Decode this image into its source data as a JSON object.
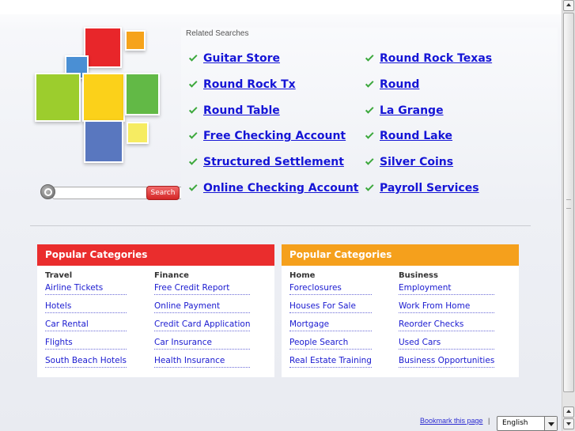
{
  "colors": {
    "red_header": "#ea2d2d",
    "orange_header": "#f5a01c",
    "link": "#1515d6",
    "check": "#3ca83c"
  },
  "search": {
    "placeholder": "",
    "button_label": "Search"
  },
  "related": {
    "title": "Related Searches",
    "left": [
      "Guitar Store",
      "Round Rock Tx",
      "Round Table",
      "Free Checking Account",
      "Structured Settlement",
      "Online Checking Account"
    ],
    "right": [
      "Round Rock Texas",
      "Round",
      "La Grange",
      "Round Lake",
      "Silver Coins",
      "Payroll Services"
    ]
  },
  "categories": [
    {
      "header": "Popular Categories",
      "columns": [
        {
          "title": "Travel",
          "links": [
            "Airline Tickets",
            "Hotels",
            "Car Rental",
            "Flights",
            "South Beach Hotels"
          ]
        },
        {
          "title": "Finance",
          "links": [
            "Free Credit Report",
            "Online Payment",
            "Credit Card Application",
            "Car Insurance",
            "Health Insurance"
          ]
        }
      ]
    },
    {
      "header": "Popular Categories",
      "columns": [
        {
          "title": "Home",
          "links": [
            "Foreclosures",
            "Houses For Sale",
            "Mortgage",
            "People Search",
            "Real Estate Training"
          ]
        },
        {
          "title": "Business",
          "links": [
            "Employment",
            "Work From Home",
            "Reorder Checks",
            "Used Cars",
            "Business Opportunities"
          ]
        }
      ]
    }
  ],
  "footer": {
    "bookmark_label": "Bookmark this page",
    "separator": "|",
    "language": "English"
  }
}
